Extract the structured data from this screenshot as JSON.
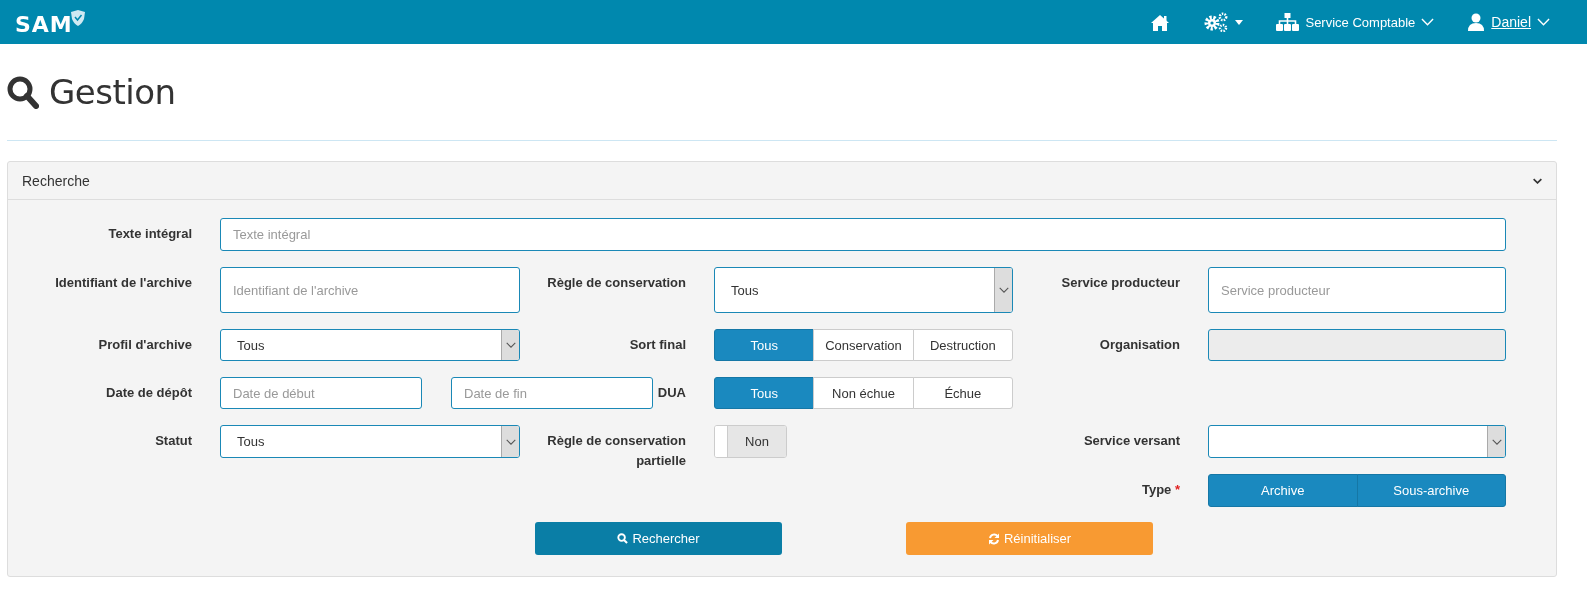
{
  "navbar": {
    "logo": "SAM",
    "service": "Service Comptable",
    "user": "Daniel"
  },
  "page": {
    "title": "Gestion"
  },
  "panel": {
    "title": "Recherche",
    "expanded": true,
    "fields": [
      {
        "kind": "text",
        "label": "Texte intégral",
        "placeholder": "Texte intégral"
      },
      {
        "kind": "text",
        "label": "Identifiant de l'archive",
        "placeholder": "Identifiant de l'archive"
      },
      {
        "kind": "select",
        "label": "Règle de conservation",
        "value": "Tous"
      },
      {
        "kind": "text",
        "label": "Service producteur",
        "placeholder": "Service producteur"
      },
      {
        "kind": "select",
        "label": "Profil d'archive",
        "value": "Tous"
      },
      {
        "kind": "segmented",
        "label": "Sort final",
        "options": [
          {
            "label": "Tous",
            "selected": true
          },
          {
            "label": "Conservation",
            "selected": false
          },
          {
            "label": "Destruction",
            "selected": false
          }
        ]
      },
      {
        "kind": "readonly",
        "label": "Organisation"
      },
      {
        "kind": "daterange",
        "label": "Date de dépôt",
        "placeholder_start": "Date de début",
        "placeholder_end": "Date de fin"
      },
      {
        "kind": "segmented",
        "label": "DUA",
        "options": [
          {
            "label": "Tous",
            "selected": true
          },
          {
            "label": "Non échue",
            "selected": false
          },
          {
            "label": "Échue",
            "selected": false
          }
        ]
      },
      {
        "kind": "select",
        "label": "Statut",
        "value": "Tous"
      },
      {
        "kind": "toggle",
        "label": "Règle de conservation partielle",
        "on": false,
        "state_label": "Non"
      },
      {
        "kind": "select",
        "label": "Service versant"
      },
      {
        "kind": "segmented",
        "label": "Type",
        "required_mark": "*",
        "options": [
          {
            "label": "Archive",
            "selected": true
          },
          {
            "label": "Sous-archive",
            "selected": true
          }
        ]
      }
    ],
    "buttons": [
      {
        "kind": "search",
        "label": "Rechercher"
      },
      {
        "kind": "reset",
        "label": "Réinitialiser"
      }
    ]
  }
}
